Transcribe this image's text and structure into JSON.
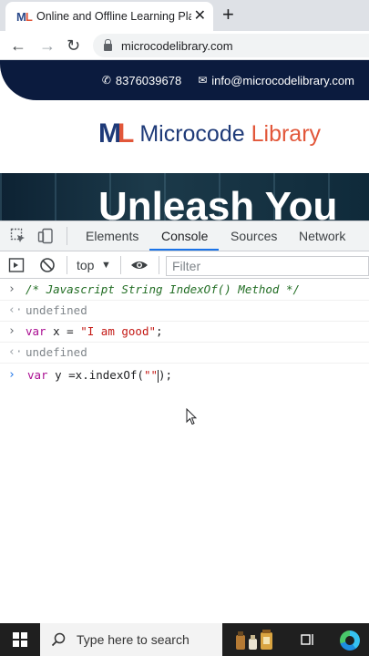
{
  "browser": {
    "tab": {
      "favicon_text": "ML",
      "title": "Online and Offline Learning Platf",
      "close_icon": "close-icon"
    },
    "new_tab_icon": "plus-icon",
    "nav": {
      "back_icon": "arrow-left-icon",
      "forward_icon": "arrow-right-icon",
      "reload_icon": "reload-icon"
    },
    "url": "microcodelibrary.com"
  },
  "site": {
    "phone": "8376039678",
    "email": "info@microcodelibrary.com",
    "brand": {
      "first": "Microcode",
      "second": "Library"
    },
    "hero_text": "Unleash You",
    "colors": {
      "navy": "#1e3a78",
      "accent": "#e2573a",
      "banner": "#0b1b3e"
    }
  },
  "devtools": {
    "tabs": [
      {
        "label": "Elements",
        "active": false
      },
      {
        "label": "Console",
        "active": true
      },
      {
        "label": "Sources",
        "active": false
      },
      {
        "label": "Network",
        "active": false
      }
    ],
    "context": "top",
    "filter_placeholder": "Filter",
    "console_lines": [
      {
        "kind": "input",
        "text": "/* Javascript String IndexOf() Method */"
      },
      {
        "kind": "result",
        "text": "undefined"
      },
      {
        "kind": "input",
        "keyword": "var",
        "ident": " x = ",
        "string": "\"I am good\"",
        "tail": ";"
      },
      {
        "kind": "result",
        "text": "undefined"
      }
    ],
    "prompt": {
      "keyword": "var",
      "ident": " y =x.indexOf(",
      "string": "\"\"",
      "tail": ");"
    }
  },
  "taskbar": {
    "search_placeholder": "Type here to search",
    "colors": {
      "bg": "#1f1f1f",
      "search_bg": "#f3f3f3"
    }
  }
}
